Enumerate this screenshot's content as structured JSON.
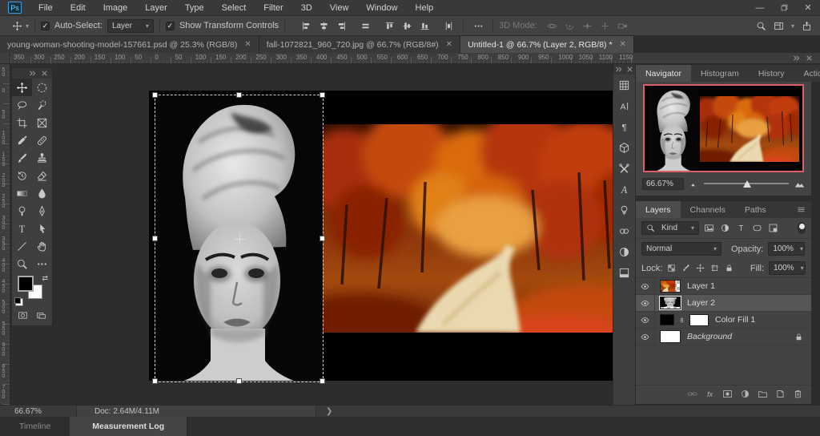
{
  "app": {
    "logo_text": "Ps"
  },
  "window_controls": {
    "minimize": "minimize-icon",
    "restore": "restore-icon",
    "close": "close-icon"
  },
  "menu_bar": {
    "items": [
      "File",
      "Edit",
      "Image",
      "Layer",
      "Type",
      "Select",
      "Filter",
      "3D",
      "View",
      "Window",
      "Help"
    ]
  },
  "options_bar": {
    "active_tool_icon": "move",
    "auto_select": {
      "checked": true,
      "label": "Auto-Select:",
      "value": "Layer"
    },
    "show_transform": {
      "checked": true,
      "label": "Show Transform Controls"
    },
    "align_icons": [
      "align-left",
      "align-center-h",
      "align-right",
      "equal-spacing",
      "align-top",
      "align-middle",
      "align-bottom",
      "distribute-h"
    ],
    "more_icon": "edit-toolbar",
    "mode_label": "3D Mode:",
    "mode_icons": [
      "orbit-3d",
      "roll-3d",
      "drag-3d",
      "slide-3d",
      "camera-3d"
    ],
    "right_icons": [
      "search",
      "workspace",
      "chevron-down",
      "share"
    ]
  },
  "document_tabs": [
    {
      "label": "young-woman-shooting-model-157661.psd @ 25.3% (RGB/8)",
      "active": false
    },
    {
      "label": "fall-1072821_960_720.jpg @ 66.7% (RGB/8#)",
      "active": false
    },
    {
      "label": "Untitled-1 @ 66.7% (Layer 2, RGB/8) *",
      "active": true
    }
  ],
  "rulers": {
    "horizontal": [
      "350",
      "300",
      "250",
      "200",
      "150",
      "100",
      "50",
      "0",
      "50",
      "100",
      "150",
      "200",
      "250",
      "300",
      "350",
      "400",
      "450",
      "500",
      "550",
      "600",
      "650",
      "700",
      "750",
      "800",
      "850",
      "900",
      "950",
      "1000",
      "1050",
      "1100",
      "1150"
    ],
    "vertical": [
      "50",
      "0",
      "50",
      "100",
      "150",
      "200",
      "250",
      "300",
      "350",
      "400",
      "450",
      "500",
      "550",
      "600",
      "650",
      "700"
    ]
  },
  "toolbar": {
    "tools": [
      {
        "name": "move",
        "selected": true
      },
      {
        "name": "marquee"
      },
      {
        "name": "lasso"
      },
      {
        "name": "quick-select"
      },
      {
        "name": "crop"
      },
      {
        "name": "frame"
      },
      {
        "name": "eyedropper"
      },
      {
        "name": "healing"
      },
      {
        "name": "brush"
      },
      {
        "name": "clone-stamp"
      },
      {
        "name": "history-brush"
      },
      {
        "name": "eraser"
      },
      {
        "name": "gradient"
      },
      {
        "name": "blur"
      },
      {
        "name": "dodge"
      },
      {
        "name": "pen"
      },
      {
        "name": "type"
      },
      {
        "name": "path-select"
      },
      {
        "name": "line"
      },
      {
        "name": "hand"
      },
      {
        "name": "zoom"
      },
      {
        "name": "edit-toolbar"
      }
    ]
  },
  "panel_strip": [
    "swatches",
    "character",
    "paragraph",
    "3d-panel",
    "tool-presets",
    "glyphs",
    "learn",
    "libraries",
    "adjustments",
    "stock"
  ],
  "navigator": {
    "tabs": [
      {
        "label": "Navigator",
        "active": true
      },
      {
        "label": "Histogram",
        "active": false
      },
      {
        "label": "History",
        "active": false
      },
      {
        "label": "Actions",
        "active": false
      }
    ],
    "zoom_value": "66.67%",
    "proxy_border_color": "#d95f6b"
  },
  "layers_panel": {
    "tabs": [
      {
        "label": "Layers",
        "active": true
      },
      {
        "label": "Channels",
        "active": false
      },
      {
        "label": "Paths",
        "active": false
      }
    ],
    "filter": {
      "label": "Kind",
      "icons": [
        "pixel-layer",
        "adjustment-layer",
        "type-layer",
        "shape-layer",
        "smart-object"
      ]
    },
    "blend_mode": "Normal",
    "opacity_label": "Opacity:",
    "opacity_value": "100%",
    "lock_label": "Lock:",
    "lock_icons": [
      "lock-transparency",
      "lock-pixels",
      "lock-position",
      "lock-artboard",
      "lock-all"
    ],
    "fill_label": "Fill:",
    "fill_value": "100%",
    "layers": [
      {
        "name": "Layer 1",
        "thumb": "autumn",
        "visible": true,
        "selected": false,
        "italic": false,
        "locked": false,
        "color_fill": false
      },
      {
        "name": "Layer 2",
        "thumb": "woman",
        "visible": true,
        "selected": true,
        "italic": false,
        "locked": false,
        "color_fill": false
      },
      {
        "name": "Color Fill 1",
        "thumb": "color-fill",
        "visible": true,
        "selected": false,
        "italic": false,
        "locked": false,
        "color_fill": true
      },
      {
        "name": "Background",
        "thumb": "white",
        "visible": true,
        "selected": false,
        "italic": true,
        "locked": true,
        "color_fill": false
      }
    ],
    "bottom_icons": [
      "link-layers",
      "layer-effects",
      "layer-mask",
      "adjustment-layer",
      "group-layers",
      "new-layer",
      "delete-layer"
    ]
  },
  "status_bar": {
    "zoom": "66.67%",
    "doc_info": "Doc: 2.64M/4.11M",
    "chevron": "❯"
  },
  "bottom_tabs": [
    {
      "label": "Timeline",
      "active": false
    },
    {
      "label": "Measurement Log",
      "active": true
    }
  ]
}
